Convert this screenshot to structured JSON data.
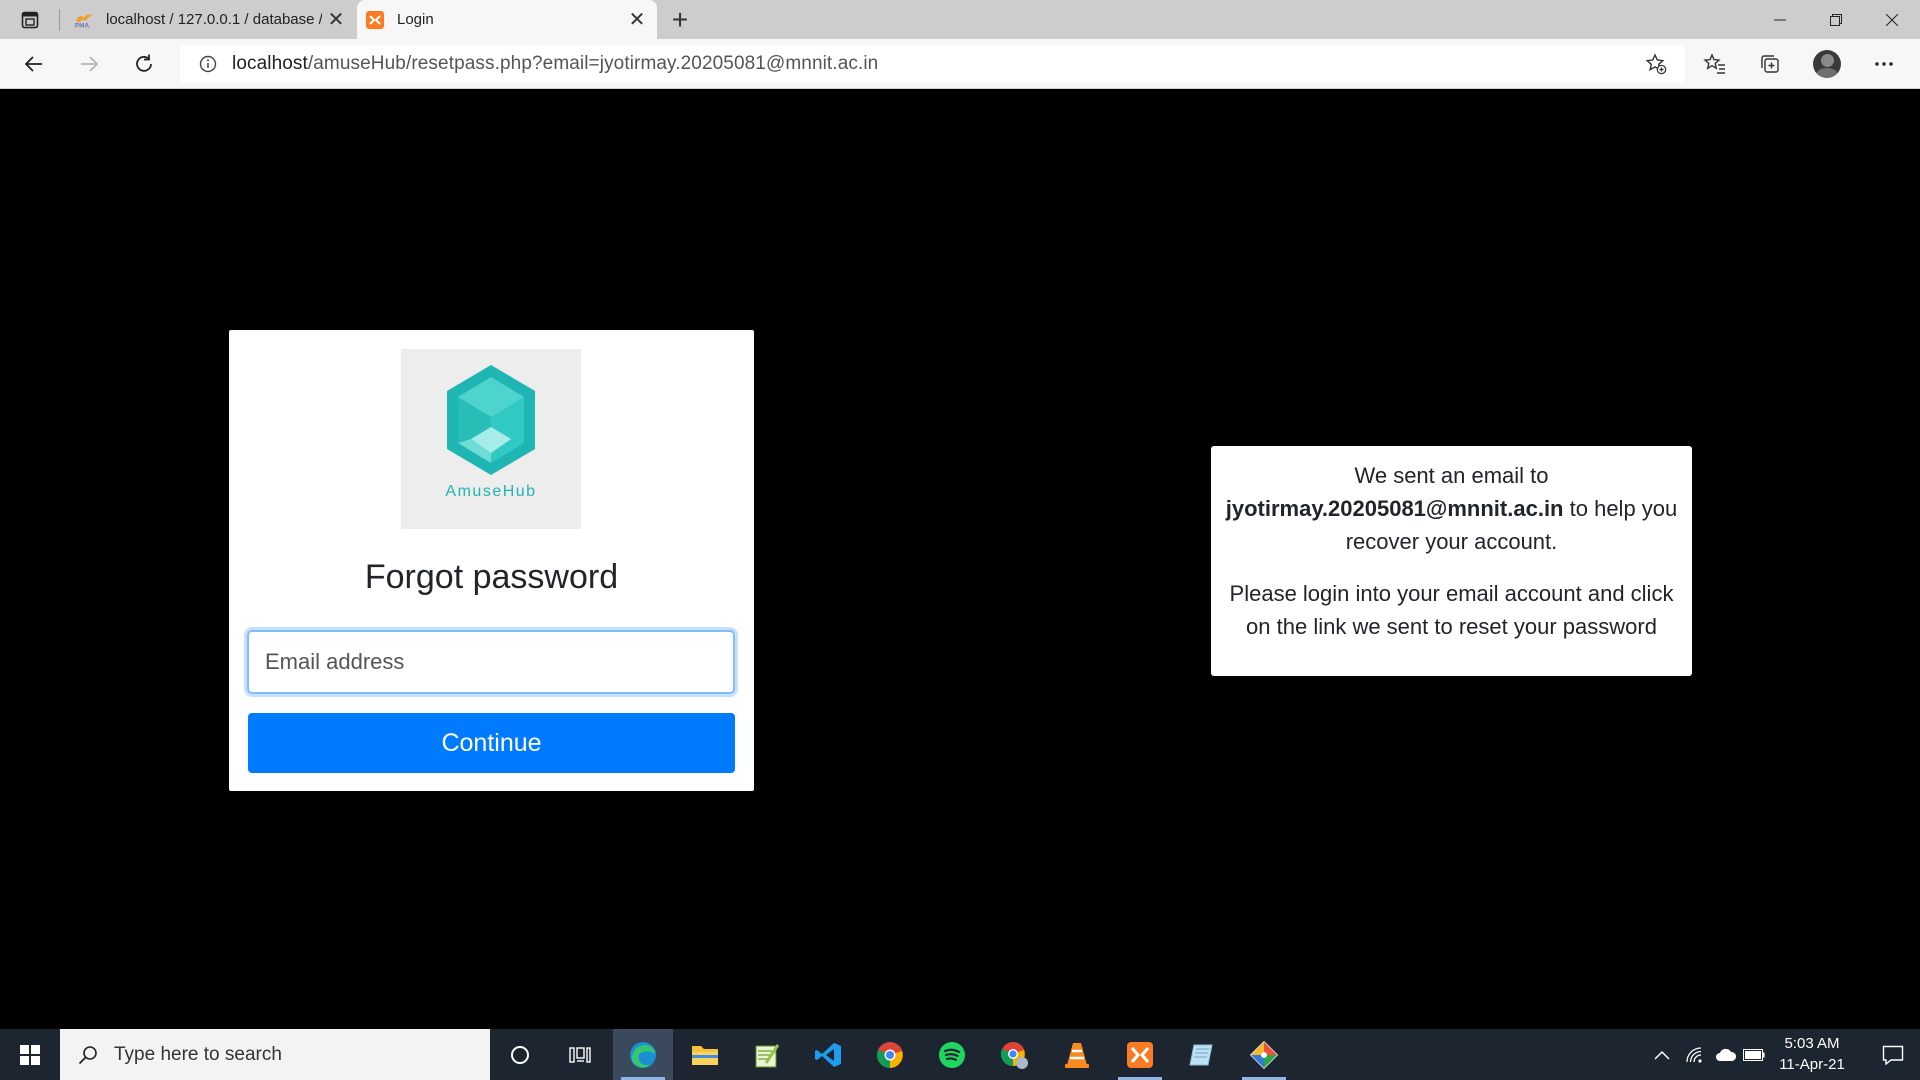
{
  "browser": {
    "tabs": [
      {
        "title": "localhost / 127.0.0.1 / database / ",
        "favicon": "phpmyadmin-icon",
        "active": false
      },
      {
        "title": "Login",
        "favicon": "xampp-icon",
        "active": true
      }
    ],
    "url": {
      "host": "localhost",
      "rest": "/amuseHub/resetpass.php?email=jyotirmay.20205081@mnnit.ac.in"
    }
  },
  "login_card": {
    "brand": "AmuseHub",
    "title": "Forgot password",
    "email_placeholder": "Email address",
    "email_value": "",
    "submit_label": "Continue",
    "accent_color": "#007bff",
    "brand_color": "#21b5b3"
  },
  "notice": {
    "line1_prefix": "We sent an email to",
    "email": "jyotirmay.20205081@mnnit.ac.in",
    "line1_suffix": "to help you recover your account.",
    "line2": "Please login into your email account and click on the link we sent to reset your password"
  },
  "taskbar": {
    "search_placeholder": "Type here to search",
    "apps": [
      "cortana-icon",
      "task-view-icon",
      "edge-icon",
      "file-explorer-icon",
      "notepadpp-icon",
      "vscode-icon",
      "chrome-icon",
      "spotify-icon",
      "chrome-profile-icon",
      "vlc-icon",
      "xampp-icon",
      "notepad-icon",
      "git-icon"
    ],
    "time": "5:03 AM",
    "date": "11-Apr-21"
  }
}
